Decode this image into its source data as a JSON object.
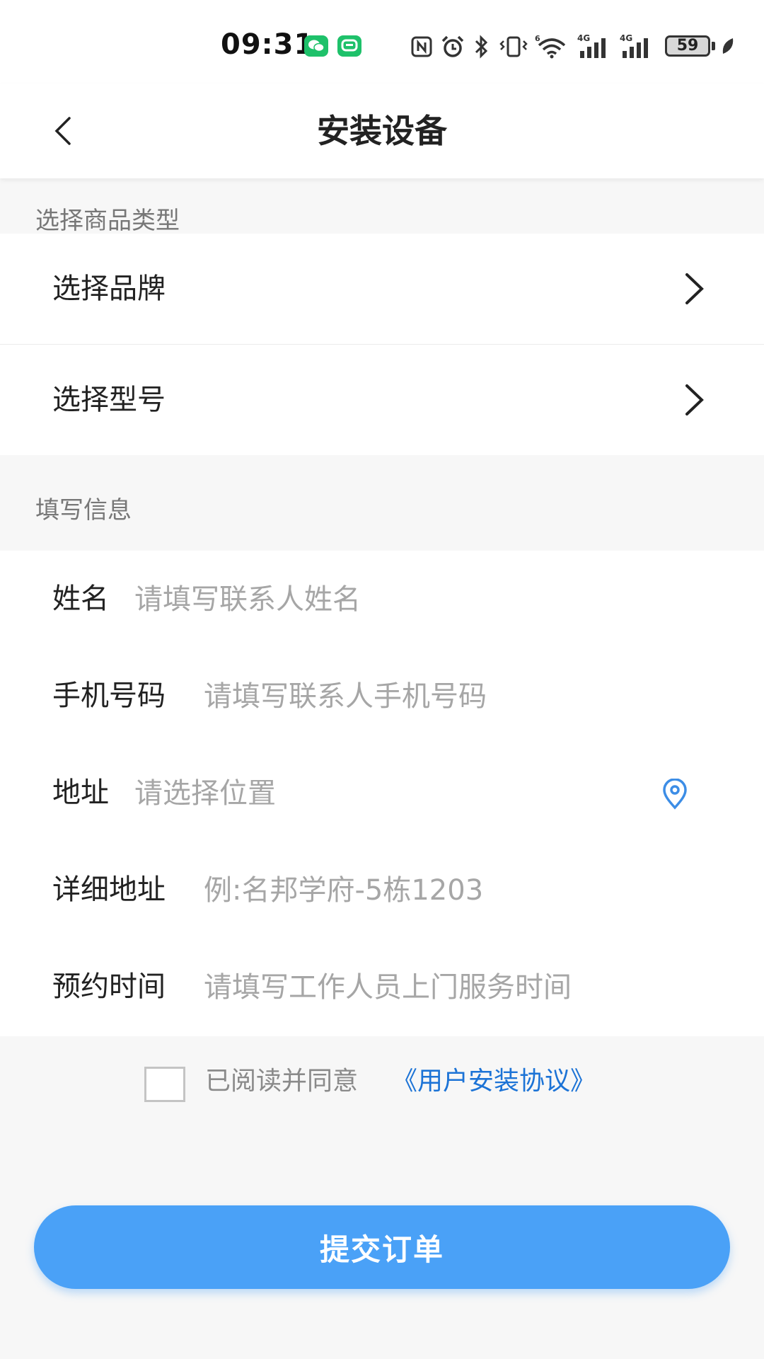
{
  "status_bar": {
    "time": "09:31",
    "battery": "59",
    "icons": [
      "wechat-icon",
      "message-icon",
      "nfc-icon",
      "alarm-icon",
      "bluetooth-icon",
      "vibrate-icon",
      "wifi-icon",
      "signal-4g-icon",
      "signal-4g-icon",
      "battery-icon",
      "leaf-icon"
    ]
  },
  "header": {
    "title": "安装设备",
    "back_icon": "chevron-left-icon"
  },
  "product_section": {
    "label": "选择商品类型",
    "items": [
      {
        "label": "选择品牌",
        "icon": "chevron-right-icon"
      },
      {
        "label": "选择型号",
        "icon": "chevron-right-icon"
      }
    ]
  },
  "info_section": {
    "label": "填写信息"
  },
  "form": {
    "fields": [
      {
        "label": "姓名",
        "placeholder": "请填写联系人姓名",
        "value": ""
      },
      {
        "label": "手机号码",
        "placeholder": "请填写联系人手机号码",
        "value": ""
      },
      {
        "label": "地址",
        "placeholder": "请选择位置",
        "value": "",
        "icon": "location-pin-icon"
      },
      {
        "label": "详细地址",
        "placeholder": "例:名邦学府-5栋1203",
        "value": ""
      },
      {
        "label": "预约时间",
        "placeholder": "请填写工作人员上门服务时间",
        "value": ""
      }
    ]
  },
  "agreement": {
    "checked": false,
    "text": "已阅读并同意",
    "link": "《用户安装协议》"
  },
  "submit": {
    "label": "提交订单"
  },
  "colors": {
    "accent": "#4aa1f7",
    "link": "#1c73d6",
    "background": "#f7f7f7",
    "wechat_green": "#1ec16a"
  }
}
